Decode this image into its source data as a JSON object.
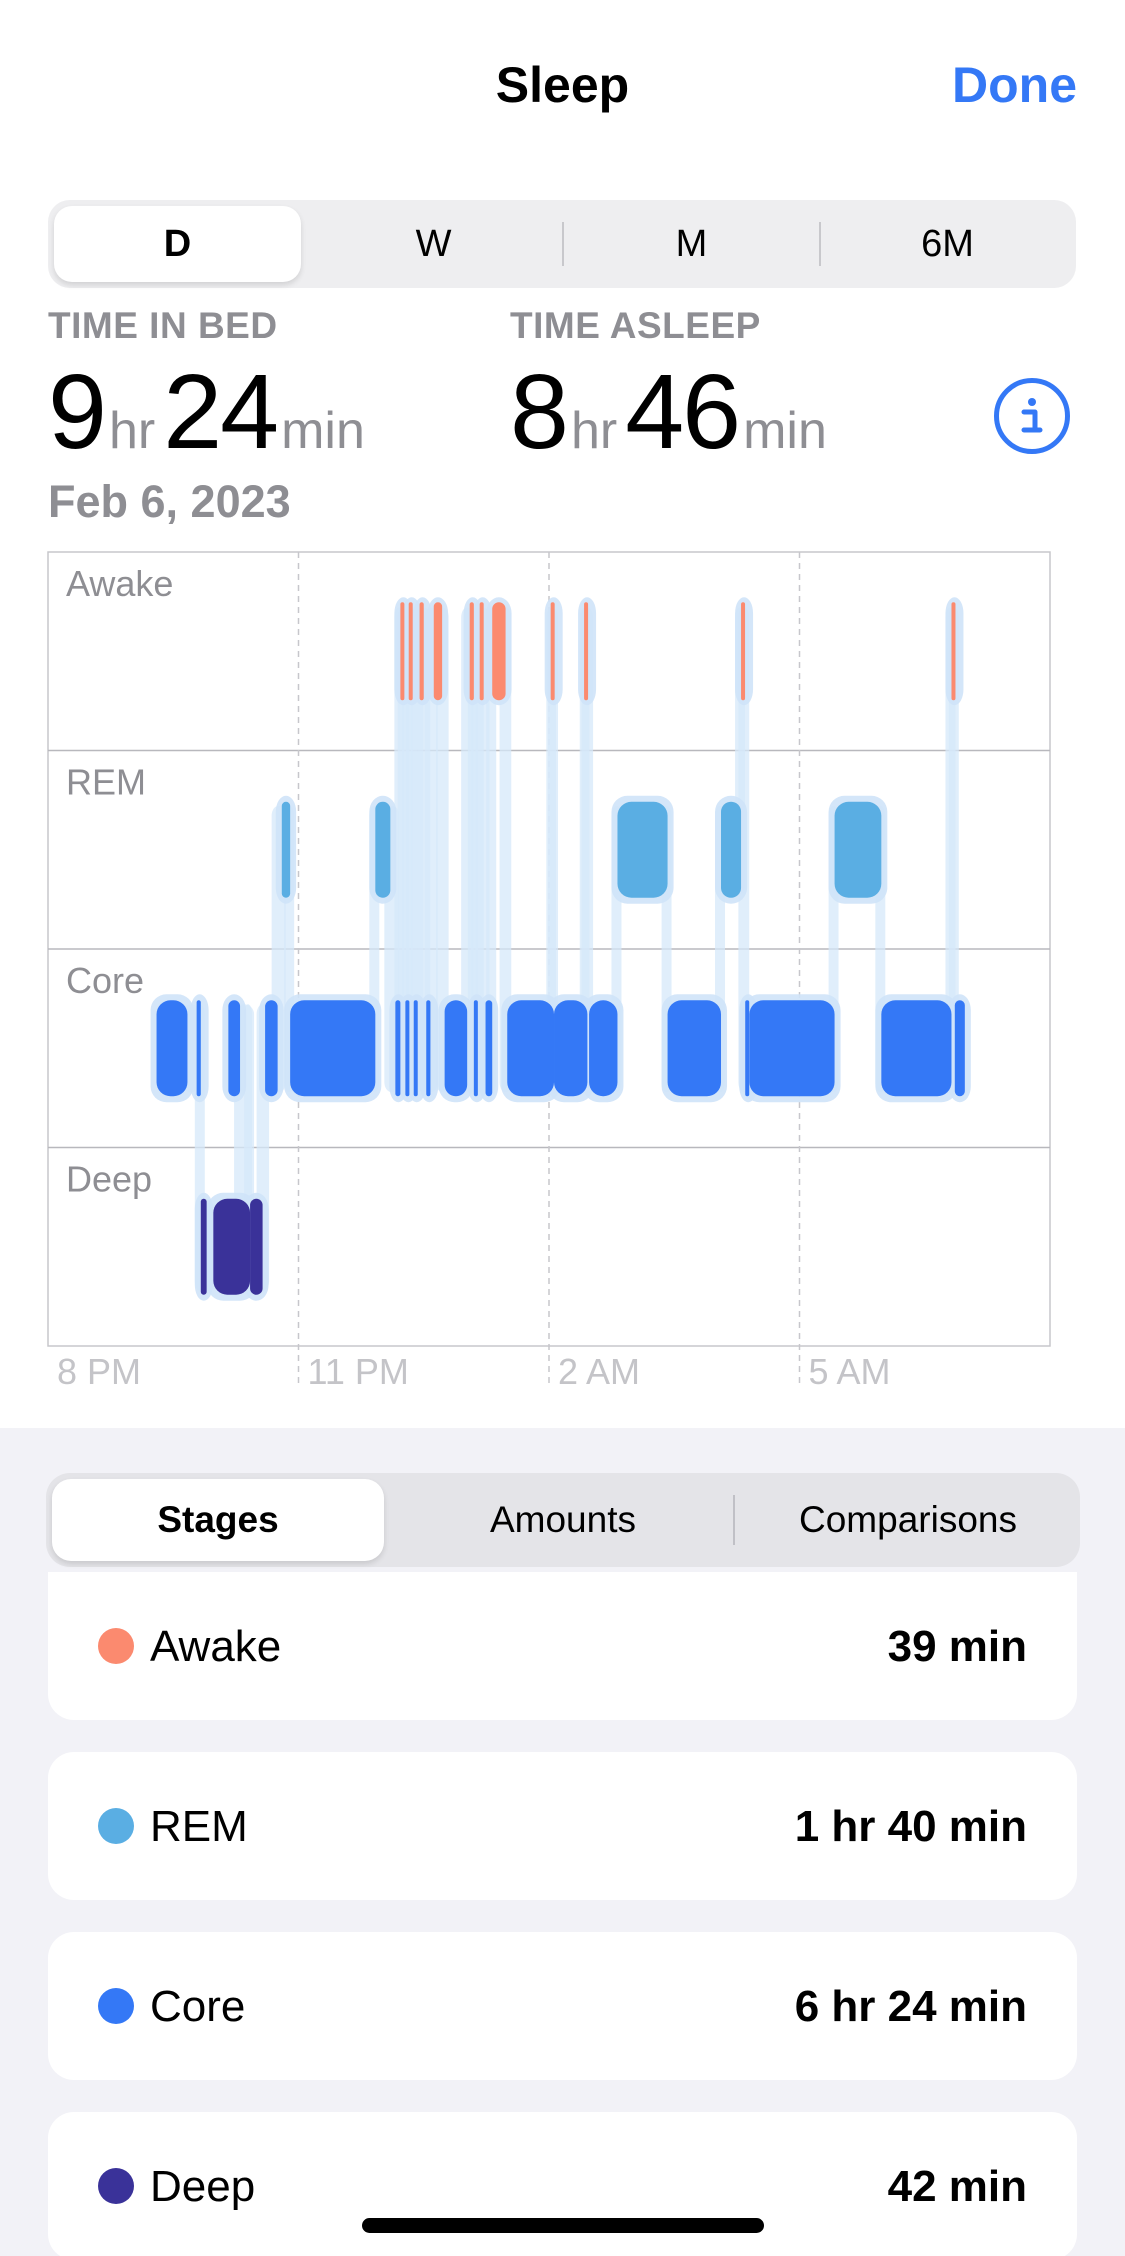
{
  "header": {
    "title": "Sleep",
    "done_label": "Done"
  },
  "period_tabs": [
    {
      "label": "D",
      "active": true
    },
    {
      "label": "W",
      "active": false
    },
    {
      "label": "M",
      "active": false
    },
    {
      "label": "6M",
      "active": false
    }
  ],
  "summary": {
    "time_in_bed": {
      "label": "TIME IN BED",
      "hours": "9",
      "hr_unit": "hr",
      "minutes": "24",
      "min_unit": "min"
    },
    "time_asleep": {
      "label": "TIME ASLEEP",
      "hours": "8",
      "hr_unit": "hr",
      "minutes": "46",
      "min_unit": "min"
    },
    "date": "Feb 6, 2023",
    "info_icon": "info-circle-icon"
  },
  "chart_data": {
    "type": "timeline",
    "stage_rows": [
      "Awake",
      "REM",
      "Core",
      "Deep"
    ],
    "x_ticks": [
      "8 PM",
      "11 PM",
      "2 AM",
      "5 AM"
    ],
    "x_range_hours": [
      20,
      32
    ],
    "colors": {
      "Awake": "#fb8a6f",
      "REM": "#5aaee3",
      "Core": "#3478f6",
      "Deep": "#3a3299"
    },
    "segments": [
      {
        "stage": "Core",
        "start": 21.3,
        "end": 21.67
      },
      {
        "stage": "Core",
        "start": 21.78,
        "end": 21.83
      },
      {
        "stage": "Deep",
        "start": 21.83,
        "end": 21.9
      },
      {
        "stage": "Deep",
        "start": 21.98,
        "end": 22.42
      },
      {
        "stage": "Core",
        "start": 22.16,
        "end": 22.3
      },
      {
        "stage": "Deep",
        "start": 22.42,
        "end": 22.57
      },
      {
        "stage": "Core",
        "start": 22.6,
        "end": 22.75
      },
      {
        "stage": "REM",
        "start": 22.8,
        "end": 22.9
      },
      {
        "stage": "Core",
        "start": 22.9,
        "end": 23.92
      },
      {
        "stage": "REM",
        "start": 23.92,
        "end": 24.1
      },
      {
        "stage": "Core",
        "start": 24.16,
        "end": 24.22
      },
      {
        "stage": "Awake",
        "start": 24.22,
        "end": 24.26
      },
      {
        "stage": "Core",
        "start": 24.28,
        "end": 24.31
      },
      {
        "stage": "Awake",
        "start": 24.32,
        "end": 24.36
      },
      {
        "stage": "Core",
        "start": 24.38,
        "end": 24.42
      },
      {
        "stage": "Awake",
        "start": 24.45,
        "end": 24.5
      },
      {
        "stage": "Core",
        "start": 24.53,
        "end": 24.58
      },
      {
        "stage": "Awake",
        "start": 24.62,
        "end": 24.72
      },
      {
        "stage": "Core",
        "start": 24.75,
        "end": 25.02
      },
      {
        "stage": "Awake",
        "start": 25.05,
        "end": 25.1
      },
      {
        "stage": "Core",
        "start": 25.1,
        "end": 25.14
      },
      {
        "stage": "Awake",
        "start": 25.17,
        "end": 25.19
      },
      {
        "stage": "Core",
        "start": 25.24,
        "end": 25.32
      },
      {
        "stage": "Awake",
        "start": 25.32,
        "end": 25.48
      },
      {
        "stage": "Core",
        "start": 25.5,
        "end": 26.06
      },
      {
        "stage": "Awake",
        "start": 26.02,
        "end": 26.04
      },
      {
        "stage": "Core",
        "start": 26.06,
        "end": 26.46
      },
      {
        "stage": "Awake",
        "start": 26.42,
        "end": 26.44
      },
      {
        "stage": "Core",
        "start": 26.48,
        "end": 26.82
      },
      {
        "stage": "REM",
        "start": 26.82,
        "end": 27.42
      },
      {
        "stage": "Core",
        "start": 27.42,
        "end": 28.06
      },
      {
        "stage": "REM",
        "start": 28.06,
        "end": 28.3
      },
      {
        "stage": "Awake",
        "start": 28.3,
        "end": 28.34
      },
      {
        "stage": "Core",
        "start": 28.35,
        "end": 28.38
      },
      {
        "stage": "Core",
        "start": 28.4,
        "end": 29.42
      },
      {
        "stage": "REM",
        "start": 29.42,
        "end": 29.98
      },
      {
        "stage": "Core",
        "start": 29.98,
        "end": 30.82
      },
      {
        "stage": "Awake",
        "start": 30.82,
        "end": 30.86
      },
      {
        "stage": "Core",
        "start": 30.86,
        "end": 30.98
      }
    ]
  },
  "view_tabs": [
    {
      "label": "Stages",
      "active": true
    },
    {
      "label": "Amounts",
      "active": false
    },
    {
      "label": "Comparisons",
      "active": false
    }
  ],
  "stages": [
    {
      "name": "Awake",
      "value": "39 min",
      "color": "#fb8a6f"
    },
    {
      "name": "REM",
      "value": "1 hr 40 min",
      "color": "#5aaee3"
    },
    {
      "name": "Core",
      "value": "6 hr 24 min",
      "color": "#3478f6"
    },
    {
      "name": "Deep",
      "value": "42 min",
      "color": "#3a3299"
    }
  ]
}
